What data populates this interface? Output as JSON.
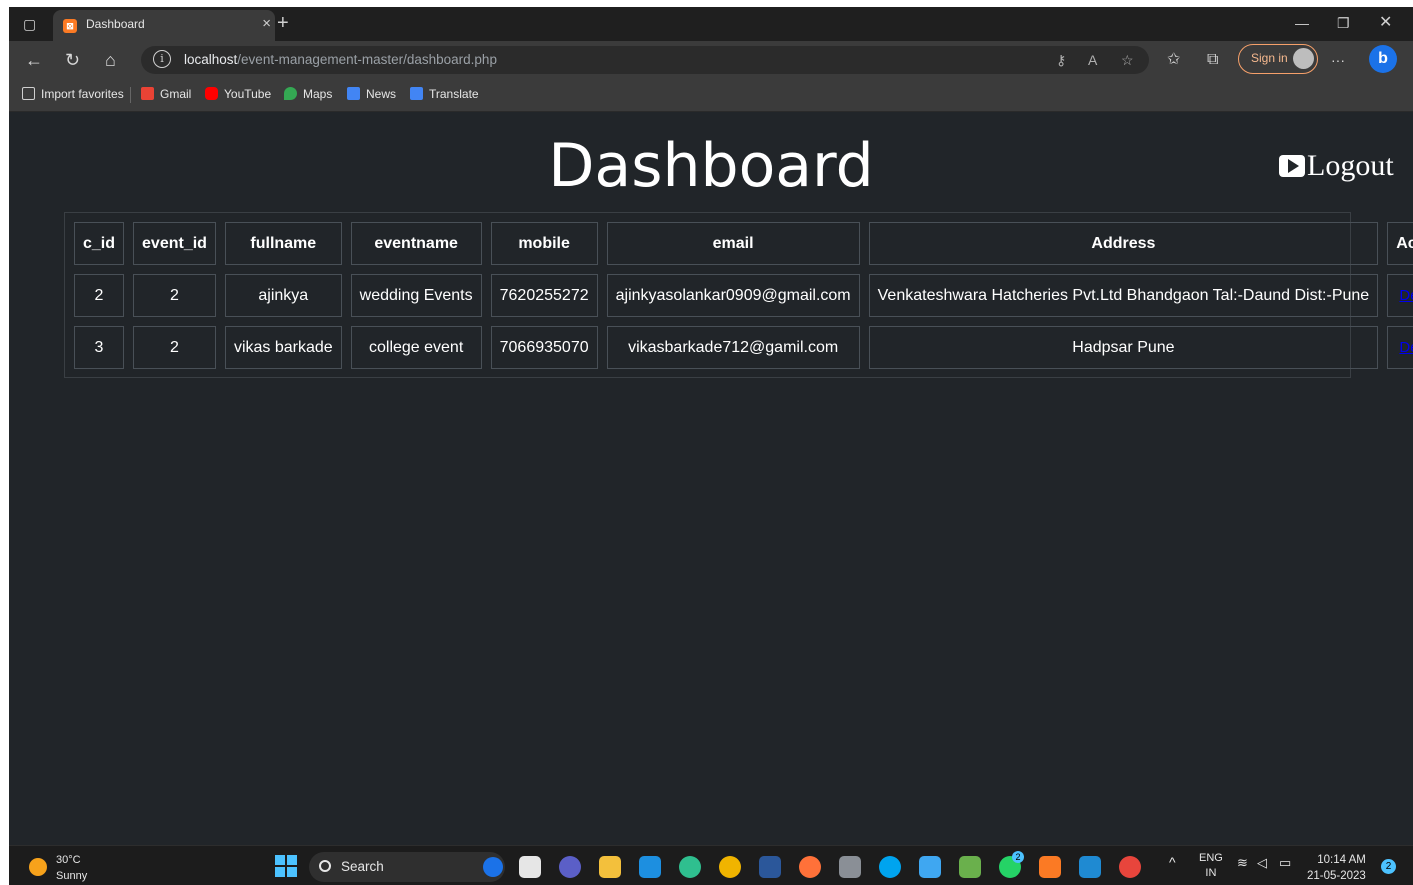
{
  "browser": {
    "tab_title": "Dashboard",
    "tab_close": "×",
    "new_tab": "+",
    "url_host": "localhost",
    "url_path": "/event-management-master/dashboard.php",
    "sign_in": "Sign in",
    "more": "···"
  },
  "favorites": [
    {
      "label": "Import favorites",
      "color": "#9aa0a6"
    },
    {
      "label": "Gmail",
      "color": "#ea4335"
    },
    {
      "label": "YouTube",
      "color": "#ff0000"
    },
    {
      "label": "Maps",
      "color": "#34a853"
    },
    {
      "label": "News",
      "color": "#4285f4"
    },
    {
      "label": "Translate",
      "color": "#4285f4"
    }
  ],
  "page": {
    "title": "Dashboard",
    "logout_label": "Logout"
  },
  "table": {
    "headers": [
      "c_id",
      "event_id",
      "fullname",
      "eventname",
      "mobile",
      "email",
      "Address",
      "Action"
    ],
    "rows": [
      {
        "c_id": "2",
        "event_id": "2",
        "fullname": "ajinkya",
        "eventname": "wedding Events",
        "mobile": "7620255272",
        "email": "ajinkyasolankar0909@gmail.com",
        "address": "Venkateshwara Hatcheries Pvt.Ltd Bhandgaon Tal:-Daund Dist:-Pune",
        "action": "Delete"
      },
      {
        "c_id": "3",
        "event_id": "2",
        "fullname": "vikas barkade",
        "eventname": "college event",
        "mobile": "7066935070",
        "email": "vikasbarkade712@gamil.com",
        "address": "Hadpsar Pune",
        "action": "Delete"
      }
    ]
  },
  "taskbar": {
    "temperature": "30°C",
    "condition": "Sunny",
    "search_label": "Search",
    "lang_top": "ENG",
    "lang_bottom": "IN",
    "time": "10:14 AM",
    "date": "21-05-2023",
    "notifications": "2",
    "whatsapp_badge": "2"
  },
  "colors": {
    "page_bg": "#212529",
    "link": "#0000ee",
    "accent": "#4cc2ff"
  }
}
